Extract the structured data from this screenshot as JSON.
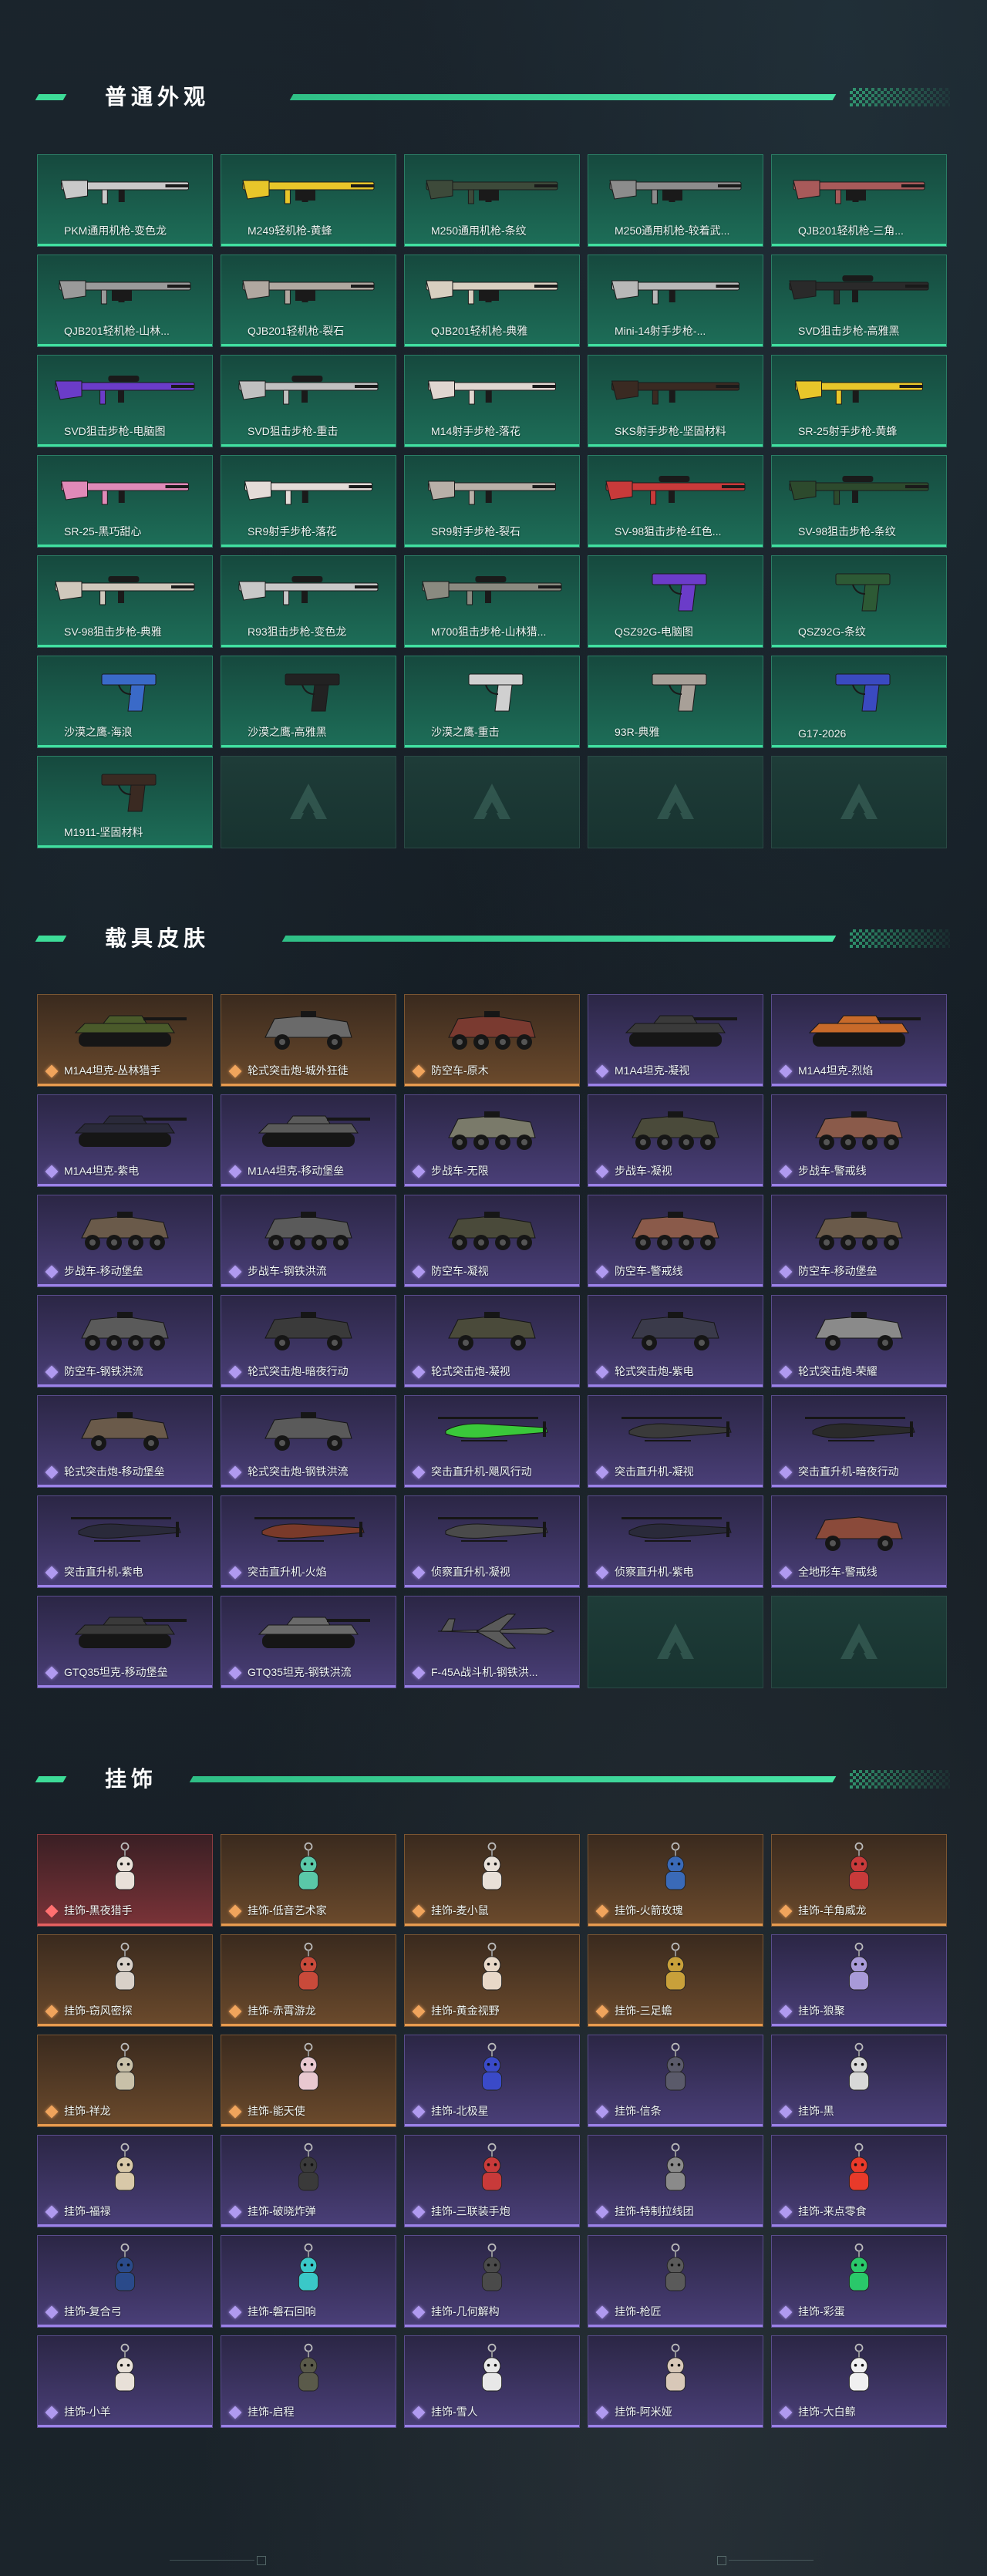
{
  "sections": {
    "weapons": {
      "title": "普通外观",
      "items": [
        {
          "label": "PKM通用机枪-变色龙",
          "kind": "rifle",
          "color": "#c9c9c9"
        },
        {
          "label": "M249轻机枪-黄蜂",
          "kind": "lmg",
          "color": "#e8c62a"
        },
        {
          "label": "M250通用机枪-条纹",
          "kind": "lmg",
          "color": "#3d4a3a"
        },
        {
          "label": "M250通用机枪-较着武...",
          "kind": "lmg",
          "color": "#8c8c8c"
        },
        {
          "label": "QJB201轻机枪-三角...",
          "kind": "lmg",
          "color": "#a85a5a"
        },
        {
          "label": "QJB201轻机枪-山林...",
          "kind": "lmg",
          "color": "#9a9a9a"
        },
        {
          "label": "QJB201轻机枪-裂石",
          "kind": "lmg",
          "color": "#b0a8a0"
        },
        {
          "label": "QJB201轻机枪-典雅",
          "kind": "lmg",
          "color": "#d8cfc0"
        },
        {
          "label": "Mini-14射手步枪-...",
          "kind": "rifle",
          "color": "#b8b8b8"
        },
        {
          "label": "SVD狙击步枪-高雅黑",
          "kind": "sniper",
          "color": "#2a2a2a"
        },
        {
          "label": "SVD狙击步枪-电脑图",
          "kind": "sniper",
          "color": "#6b3cc9"
        },
        {
          "label": "SVD狙击步枪-重击",
          "kind": "sniper",
          "color": "#c0c0c0"
        },
        {
          "label": "M14射手步枪-落花",
          "kind": "rifle",
          "color": "#e0d6d0"
        },
        {
          "label": "SKS射手步枪-坚固材料",
          "kind": "rifle",
          "color": "#3a2a22"
        },
        {
          "label": "SR-25射手步枪-黄蜂",
          "kind": "rifle",
          "color": "#e8c62a"
        },
        {
          "label": "SR-25-黑巧甜心",
          "kind": "rifle",
          "color": "#e08ab8"
        },
        {
          "label": "SR9射手步枪-落花",
          "kind": "rifle",
          "color": "#e4dcd8"
        },
        {
          "label": "SR9射手步枪-裂石",
          "kind": "rifle",
          "color": "#b8b0a8"
        },
        {
          "label": "SV-98狙击步枪-红色...",
          "kind": "sniper",
          "color": "#c83a3a"
        },
        {
          "label": "SV-98狙击步枪-条纹",
          "kind": "sniper",
          "color": "#2d4a2d"
        },
        {
          "label": "SV-98狙击步枪-典雅",
          "kind": "sniper",
          "color": "#d0c8bc"
        },
        {
          "label": "R93狙击步枪-变色龙",
          "kind": "sniper",
          "color": "#c8c8c8"
        },
        {
          "label": "M700狙击步枪-山林猎...",
          "kind": "sniper",
          "color": "#8a8a80"
        },
        {
          "label": "QSZ92G-电脑图",
          "kind": "pistol",
          "color": "#6b3cc9"
        },
        {
          "label": "QSZ92G-条纹",
          "kind": "pistol",
          "color": "#2d5a35"
        },
        {
          "label": "沙漠之鹰-海浪",
          "kind": "pistol",
          "color": "#3a6ac8"
        },
        {
          "label": "沙漠之鹰-高雅黑",
          "kind": "pistol",
          "color": "#222222"
        },
        {
          "label": "沙漠之鹰-重击",
          "kind": "pistol",
          "color": "#d0d0d0"
        },
        {
          "label": "93R-典雅",
          "kind": "pistol",
          "color": "#a8a098"
        },
        {
          "label": "G17-2026",
          "kind": "pistol",
          "color": "#3a4ac0"
        },
        {
          "label": "M1911-坚固材料",
          "kind": "pistol",
          "color": "#3a2a22"
        },
        {
          "label": "",
          "kind": "empty",
          "color": ""
        },
        {
          "label": "",
          "kind": "empty",
          "color": ""
        },
        {
          "label": "",
          "kind": "empty",
          "color": ""
        },
        {
          "label": "",
          "kind": "empty",
          "color": ""
        }
      ]
    },
    "vehicles": {
      "title": "载具皮肤",
      "items": [
        {
          "label": "M1A4坦克-丛林猎手",
          "rarity": "orange",
          "kind": "tank",
          "color": "#4a5a2a"
        },
        {
          "label": "轮式突击炮-城外狂徒",
          "rarity": "orange",
          "kind": "apc",
          "color": "#6a6a6a"
        },
        {
          "label": "防空车-原木",
          "rarity": "orange",
          "kind": "apc8",
          "color": "#7a3a30"
        },
        {
          "label": "M1A4坦克-凝视",
          "rarity": "purple",
          "kind": "tank",
          "color": "#3a3a3a"
        },
        {
          "label": "M1A4坦克-烈焰",
          "rarity": "purple",
          "kind": "tank",
          "color": "#c86a2a"
        },
        {
          "label": "M1A4坦克-紫电",
          "rarity": "purple",
          "kind": "tank",
          "color": "#2a2a3a"
        },
        {
          "label": "M1A4坦克-移动堡垒",
          "rarity": "purple",
          "kind": "tank",
          "color": "#5a5a5a"
        },
        {
          "label": "步战车-无限",
          "rarity": "purple",
          "kind": "apc8",
          "color": "#7a7a6a"
        },
        {
          "label": "步战车-凝视",
          "rarity": "purple",
          "kind": "apc8",
          "color": "#4a4a3a"
        },
        {
          "label": "步战车-警戒线",
          "rarity": "purple",
          "kind": "apc8",
          "color": "#8a5a4a"
        },
        {
          "label": "步战车-移动堡垒",
          "rarity": "purple",
          "kind": "apc8",
          "color": "#6a5a4a"
        },
        {
          "label": "步战车-钢铁洪流",
          "rarity": "purple",
          "kind": "apc8",
          "color": "#5a5a5a"
        },
        {
          "label": "防空车-凝视",
          "rarity": "purple",
          "kind": "apc8",
          "color": "#4a4a3a"
        },
        {
          "label": "防空车-警戒线",
          "rarity": "purple",
          "kind": "apc8",
          "color": "#8a5a4a"
        },
        {
          "label": "防空车-移动堡垒",
          "rarity": "purple",
          "kind": "apc8",
          "color": "#6a5a4a"
        },
        {
          "label": "防空车-钢铁洪流",
          "rarity": "purple",
          "kind": "apc8",
          "color": "#5a5a5a"
        },
        {
          "label": "轮式突击炮-暗夜行动",
          "rarity": "purple",
          "kind": "apc",
          "color": "#3a3a3a"
        },
        {
          "label": "轮式突击炮-凝视",
          "rarity": "purple",
          "kind": "apc",
          "color": "#4a4a3a"
        },
        {
          "label": "轮式突击炮-紫电",
          "rarity": "purple",
          "kind": "apc",
          "color": "#3a3a4a"
        },
        {
          "label": "轮式突击炮-荣耀",
          "rarity": "purple",
          "kind": "apc",
          "color": "#8a8a8a"
        },
        {
          "label": "轮式突击炮-移动堡垒",
          "rarity": "purple",
          "kind": "apc",
          "color": "#6a5a4a"
        },
        {
          "label": "轮式突击炮-钢铁洪流",
          "rarity": "purple",
          "kind": "apc",
          "color": "#5a5a5a"
        },
        {
          "label": "突击直升机-飓风行动",
          "rarity": "purple",
          "kind": "heli",
          "color": "#3ac83a"
        },
        {
          "label": "突击直升机-凝视",
          "rarity": "purple",
          "kind": "heli",
          "color": "#3a3a3a"
        },
        {
          "label": "突击直升机-暗夜行动",
          "rarity": "purple",
          "kind": "heli",
          "color": "#2a2a2a"
        },
        {
          "label": "突击直升机-紫电",
          "rarity": "purple",
          "kind": "heli",
          "color": "#2a2a3a"
        },
        {
          "label": "突击直升机-火焰",
          "rarity": "purple",
          "kind": "heli",
          "color": "#7a3a2a"
        },
        {
          "label": "侦察直升机-凝视",
          "rarity": "purple",
          "kind": "heli2",
          "color": "#4a4a4a"
        },
        {
          "label": "侦察直升机-紫电",
          "rarity": "purple",
          "kind": "heli2",
          "color": "#2a2a3a"
        },
        {
          "label": "全地形车-警戒线",
          "rarity": "purple",
          "kind": "atv",
          "color": "#8a4a3a"
        },
        {
          "label": "GTQ35坦克-移动堡垒",
          "rarity": "purple",
          "kind": "tank",
          "color": "#3a3a3a"
        },
        {
          "label": "GTQ35坦克-钢铁洪流",
          "rarity": "purple",
          "kind": "tank",
          "color": "#6a6a6a"
        },
        {
          "label": "F-45A战斗机-钢铁洪...",
          "rarity": "purple",
          "kind": "jet",
          "color": "#5a5a5a"
        },
        {
          "label": "",
          "rarity": "empty",
          "kind": "empty",
          "color": ""
        },
        {
          "label": "",
          "rarity": "empty",
          "kind": "empty",
          "color": ""
        }
      ]
    },
    "charms": {
      "title": "挂饰",
      "items": [
        {
          "label": "挂饰-黑夜猎手",
          "rarity": "red",
          "color": "#e8e0d8"
        },
        {
          "label": "挂饰-低音艺术家",
          "rarity": "orange",
          "color": "#5ac8a8"
        },
        {
          "label": "挂饰-麦小鼠",
          "rarity": "orange",
          "color": "#e8e0d8"
        },
        {
          "label": "挂饰-火箭玫瑰",
          "rarity": "orange",
          "color": "#3a6ab8"
        },
        {
          "label": "挂饰-羊角威龙",
          "rarity": "orange",
          "color": "#c83a3a"
        },
        {
          "label": "挂饰-窃风密探",
          "rarity": "orange",
          "color": "#d8d0c8"
        },
        {
          "label": "挂饰-赤霄游龙",
          "rarity": "orange",
          "color": "#c84a3a"
        },
        {
          "label": "挂饰-黄金视野",
          "rarity": "orange",
          "color": "#e8d8c8"
        },
        {
          "label": "挂饰-三足蟾",
          "rarity": "orange",
          "color": "#c8a03a"
        },
        {
          "label": "挂饰-狼聚",
          "rarity": "purple",
          "color": "#a89ad8"
        },
        {
          "label": "挂饰-祥龙",
          "rarity": "orange",
          "color": "#c8c0a8"
        },
        {
          "label": "挂饰-能天使",
          "rarity": "orange",
          "color": "#e8c8d0"
        },
        {
          "label": "挂饰-北极星",
          "rarity": "purple",
          "color": "#3a4ac8"
        },
        {
          "label": "挂饰-信条",
          "rarity": "purple",
          "color": "#5a5a6a"
        },
        {
          "label": "挂饰-黑",
          "rarity": "purple",
          "color": "#d8d8d8"
        },
        {
          "label": "挂饰-福禄",
          "rarity": "purple",
          "color": "#d8c8a8"
        },
        {
          "label": "挂饰-破晓炸弹",
          "rarity": "purple",
          "color": "#3a3a3a"
        },
        {
          "label": "挂饰-三联装手炮",
          "rarity": "purple",
          "color": "#c83a3a"
        },
        {
          "label": "挂饰-特制拉线团",
          "rarity": "purple",
          "color": "#8a8a8a"
        },
        {
          "label": "挂饰-来点零食",
          "rarity": "purple",
          "color": "#e83a2a"
        },
        {
          "label": "挂饰-复合弓",
          "rarity": "purple",
          "color": "#2a4a8a"
        },
        {
          "label": "挂饰-磐石回响",
          "rarity": "purple",
          "color": "#3ac8c8"
        },
        {
          "label": "挂饰-几何解构",
          "rarity": "purple",
          "color": "#4a4a4a"
        },
        {
          "label": "挂饰-枪匠",
          "rarity": "purple",
          "color": "#5a5a5a"
        },
        {
          "label": "挂饰-彩蛋",
          "rarity": "purple",
          "color": "#2ac86a"
        },
        {
          "label": "挂饰-小羊",
          "rarity": "purple",
          "color": "#e8e0d8"
        },
        {
          "label": "挂饰-启程",
          "rarity": "purple",
          "color": "#5a5a4a"
        },
        {
          "label": "挂饰-雪人",
          "rarity": "purple",
          "color": "#e8e8e8"
        },
        {
          "label": "挂饰-阿米娅",
          "rarity": "purple",
          "color": "#d8c8b8"
        },
        {
          "label": "挂饰-大白鲸",
          "rarity": "purple",
          "color": "#f0f0f0"
        }
      ]
    }
  },
  "colors": {
    "accent": "#3ddc98",
    "rarity_green": "#41e0a0",
    "rarity_orange": "#e89b4f",
    "rarity_purple": "#9b82e8",
    "rarity_red": "#e76060"
  }
}
